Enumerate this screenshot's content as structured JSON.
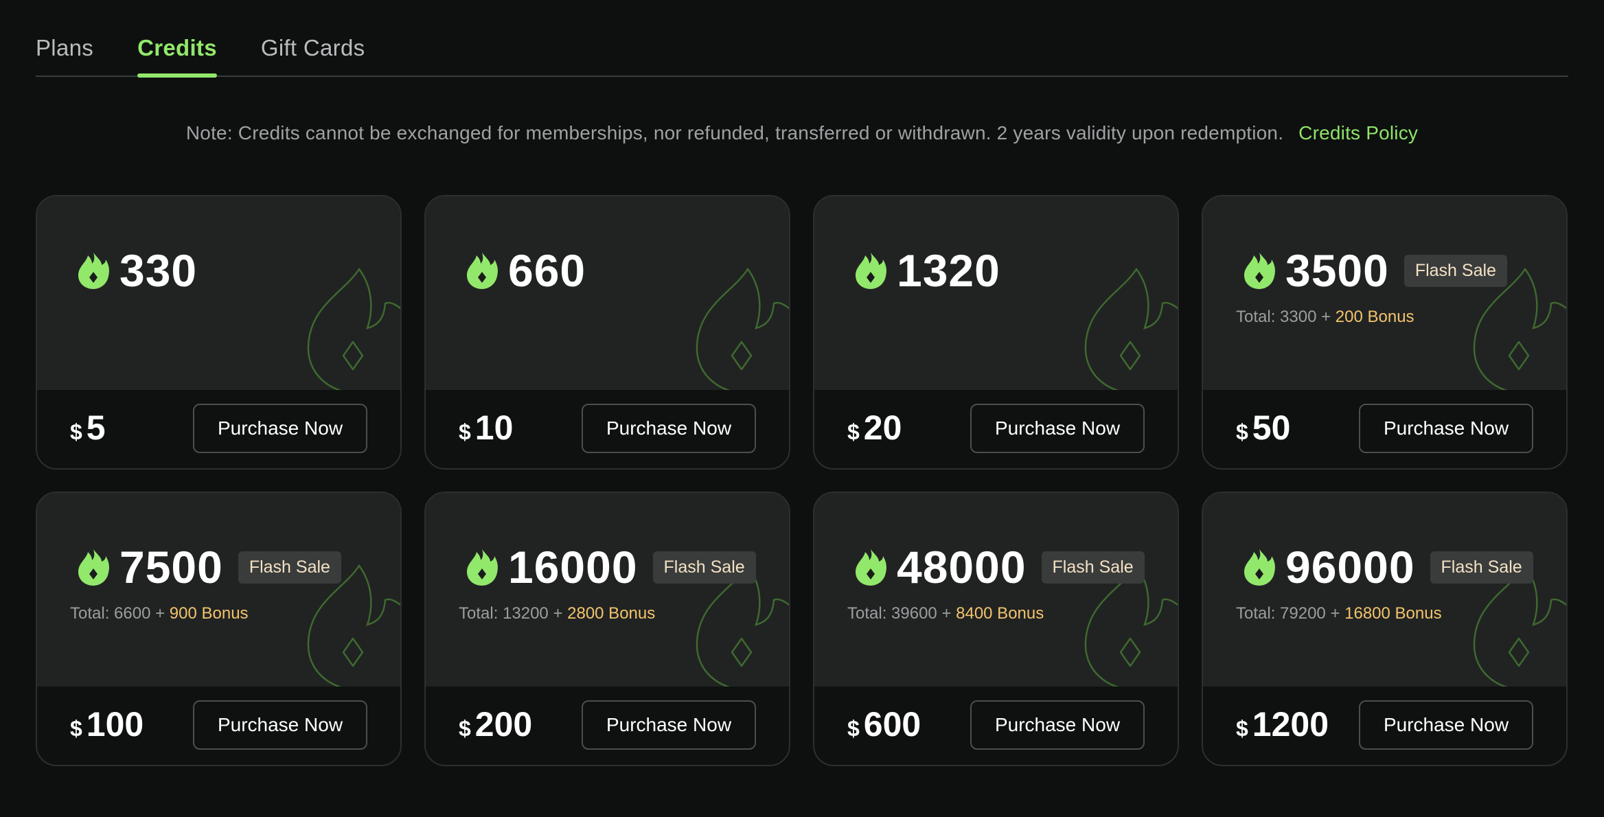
{
  "tabs": [
    {
      "label": "Plans",
      "active": false
    },
    {
      "label": "Credits",
      "active": true
    },
    {
      "label": "Gift Cards",
      "active": false
    }
  ],
  "note": {
    "text": "Note: Credits cannot be exchanged for memberships, nor refunded, transferred or withdrawn. 2 years validity upon redemption.",
    "policy_link": "Credits Policy"
  },
  "colors": {
    "accent": "#92e86b",
    "bonus": "#f3c46b",
    "background": "#0e1010",
    "card_top": "#212323"
  },
  "icons": {
    "credit": "flame-icon"
  },
  "cards": [
    {
      "credits": "330",
      "badge": "",
      "total": "",
      "bonus": "",
      "currency": "$",
      "price": "5",
      "button": "Purchase Now"
    },
    {
      "credits": "660",
      "badge": "",
      "total": "",
      "bonus": "",
      "currency": "$",
      "price": "10",
      "button": "Purchase Now"
    },
    {
      "credits": "1320",
      "badge": "",
      "total": "",
      "bonus": "",
      "currency": "$",
      "price": "20",
      "button": "Purchase Now"
    },
    {
      "credits": "3500",
      "badge": "Flash Sale",
      "total": "Total: 3300 + ",
      "bonus": "200 Bonus",
      "currency": "$",
      "price": "50",
      "button": "Purchase Now"
    },
    {
      "credits": "7500",
      "badge": "Flash Sale",
      "total": "Total: 6600 + ",
      "bonus": "900 Bonus",
      "currency": "$",
      "price": "100",
      "button": "Purchase Now"
    },
    {
      "credits": "16000",
      "badge": "Flash Sale",
      "total": "Total: 13200 + ",
      "bonus": "2800 Bonus",
      "currency": "$",
      "price": "200",
      "button": "Purchase Now"
    },
    {
      "credits": "48000",
      "badge": "Flash Sale",
      "total": "Total: 39600 + ",
      "bonus": "8400 Bonus",
      "currency": "$",
      "price": "600",
      "button": "Purchase Now"
    },
    {
      "credits": "96000",
      "badge": "Flash Sale",
      "total": "Total: 79200 + ",
      "bonus": "16800 Bonus",
      "currency": "$",
      "price": "1200",
      "button": "Purchase Now"
    }
  ]
}
